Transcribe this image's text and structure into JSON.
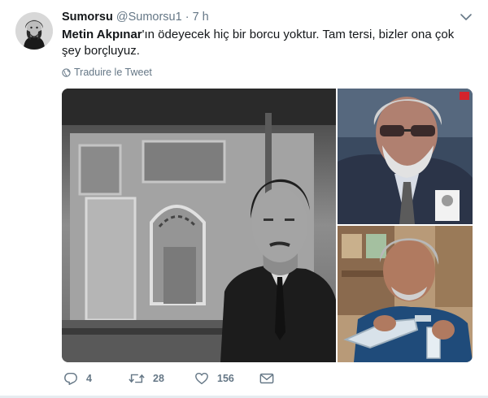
{
  "tweet": {
    "display_name": "Sumorsu",
    "handle": "@Sumorsu1",
    "separator": "·",
    "time": "7 h",
    "text_bold": "Metin Akpınar",
    "text_rest": "'ın ödeyecek hiç bir borcu yoktur. Tam tersi, bizler ona çok şey borçluyuz.",
    "translate_label": "Traduire le Tweet"
  },
  "actions": {
    "reply_count": "4",
    "retweet_count": "28",
    "like_count": "156"
  },
  "icons": {
    "avatar": "avatar",
    "menu": "chevron-down-icon",
    "translate": "globe-icon",
    "reply": "reply-icon",
    "retweet": "retweet-icon",
    "like": "heart-icon",
    "dm": "envelope-icon"
  },
  "colors": {
    "text": "#14171a",
    "secondary": "#657786",
    "divider": "#e6ecf0"
  }
}
